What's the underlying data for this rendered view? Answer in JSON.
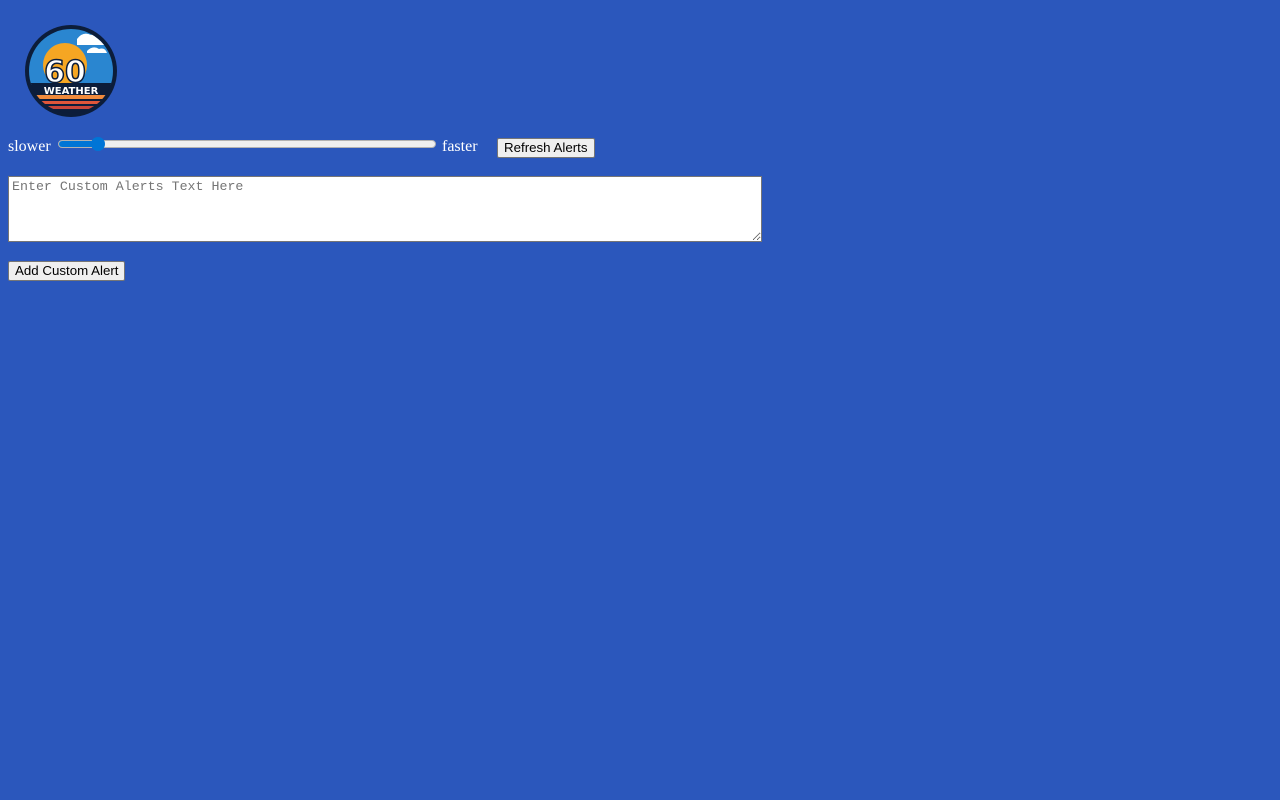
{
  "logo": {
    "number": "60",
    "word": "WEATHER"
  },
  "speed": {
    "slower_label": "slower",
    "faster_label": "faster",
    "value_fraction": 0.09
  },
  "refresh_button": "Refresh Alerts",
  "custom_alert": {
    "placeholder": "Enter Custom Alerts Text Here",
    "value": ""
  },
  "add_button": "Add Custom Alert",
  "colors": {
    "background": "#2b57bc",
    "accent": "#0075d6"
  }
}
